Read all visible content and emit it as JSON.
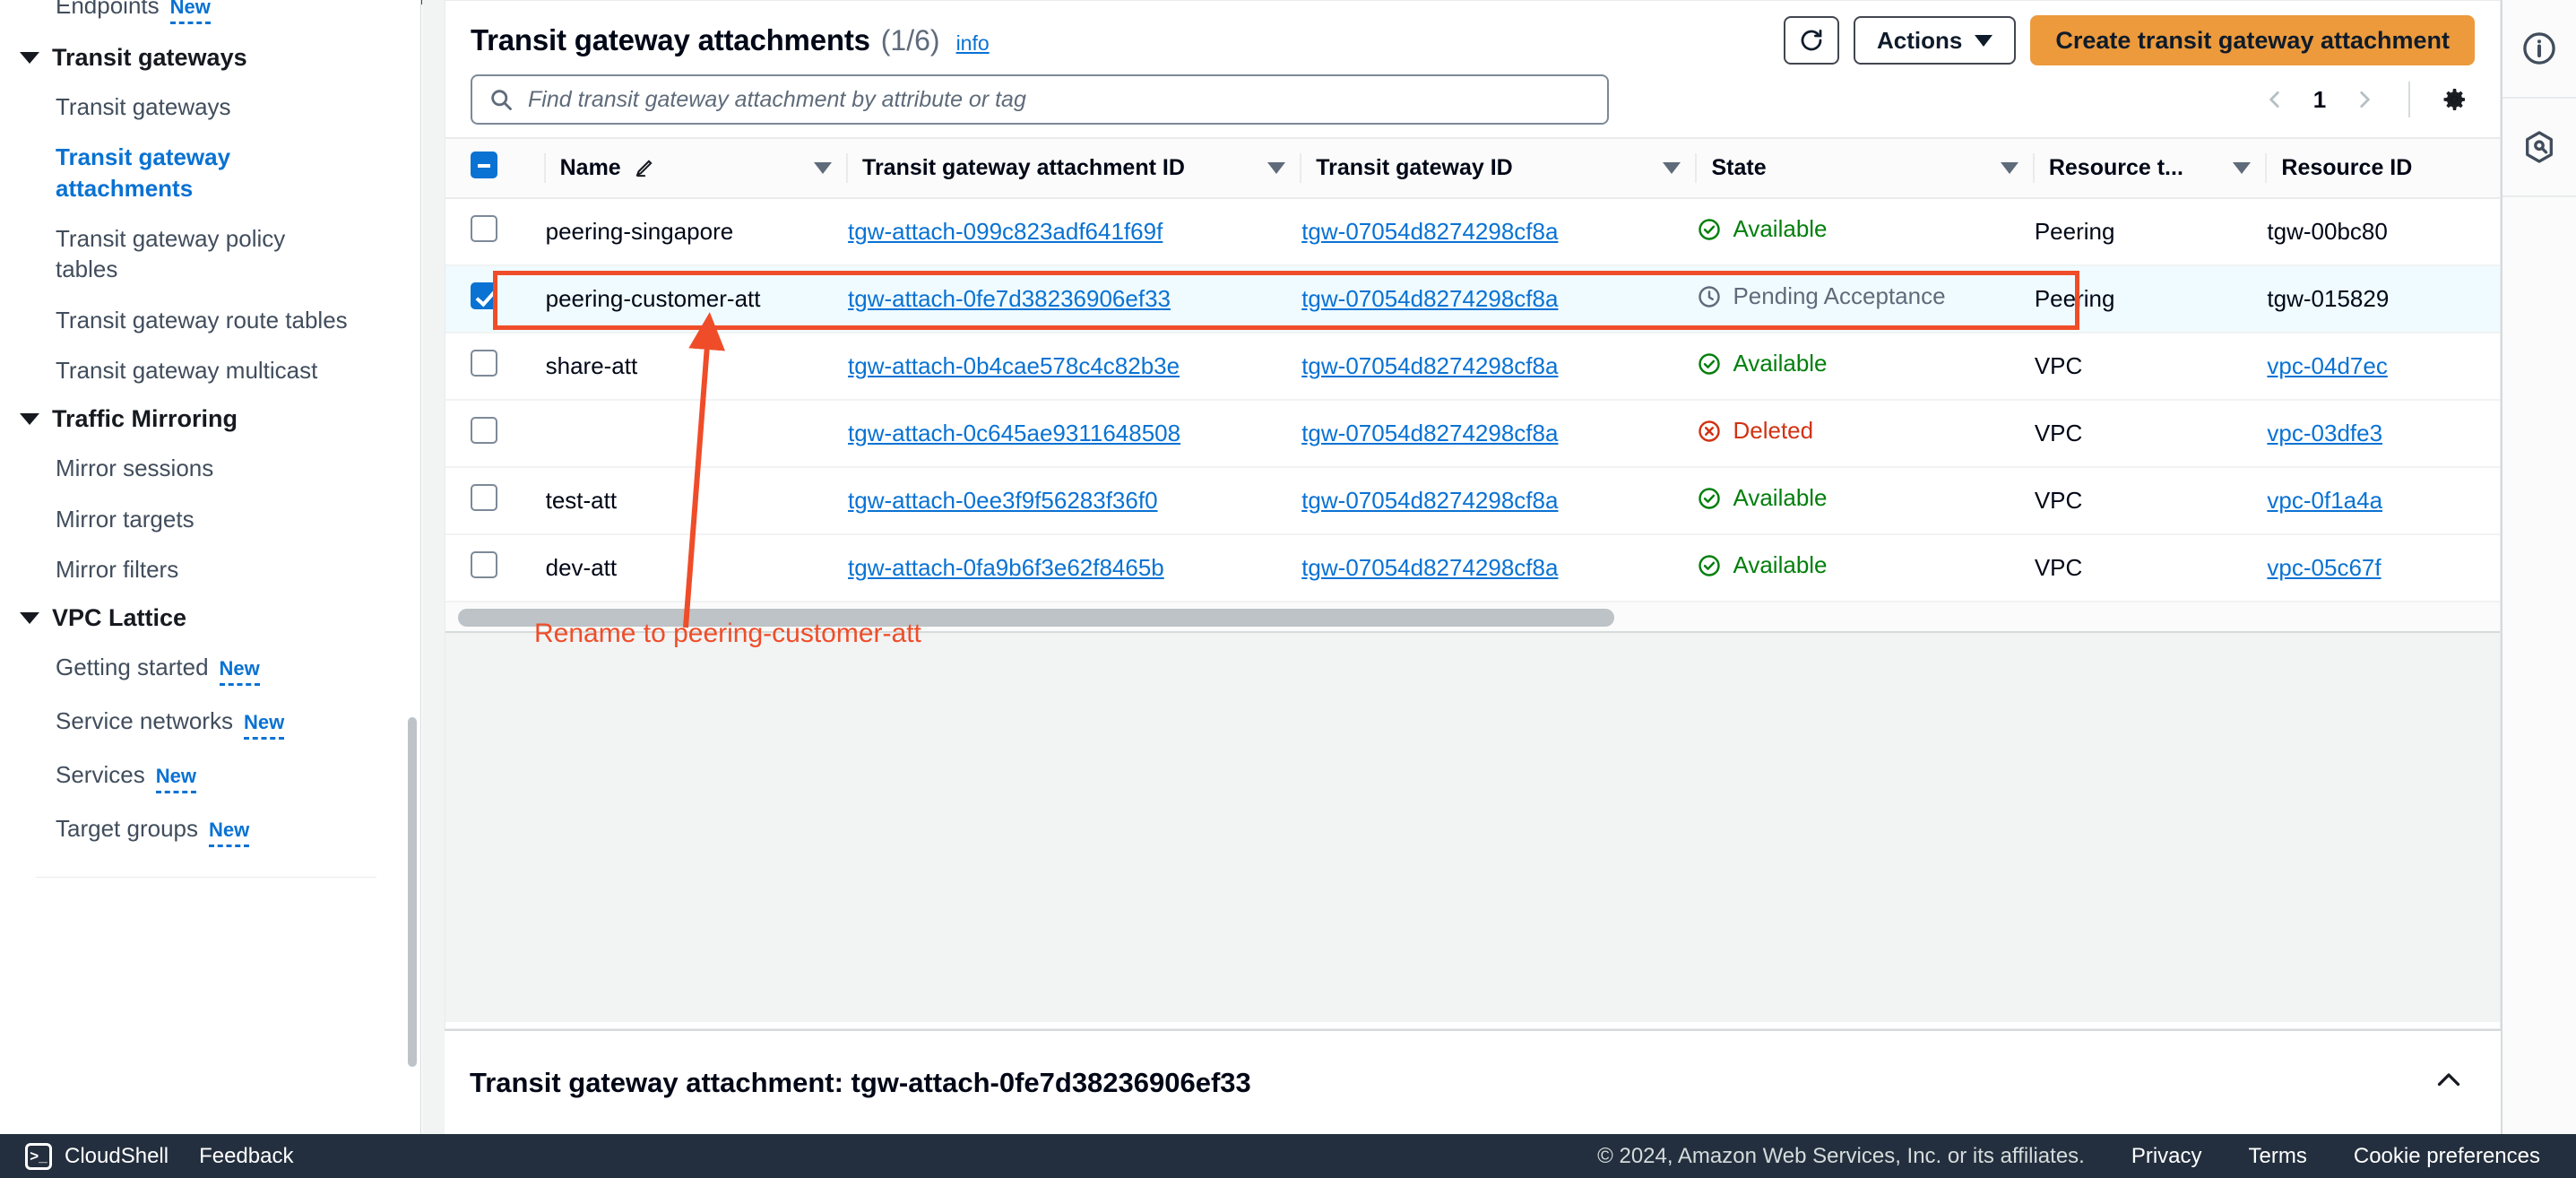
{
  "sidebar": {
    "cutoff_item": {
      "label": "Endpoints",
      "badge": "New"
    },
    "groups": [
      {
        "title": "Transit gateways",
        "items": [
          {
            "label": "Transit gateways",
            "active": false,
            "badge": ""
          },
          {
            "label": "Transit gateway attachments",
            "active": true,
            "badge": ""
          },
          {
            "label": "Transit gateway policy tables",
            "active": false,
            "badge": ""
          },
          {
            "label": "Transit gateway route tables",
            "active": false,
            "badge": ""
          },
          {
            "label": "Transit gateway multicast",
            "active": false,
            "badge": ""
          }
        ]
      },
      {
        "title": "Traffic Mirroring",
        "items": [
          {
            "label": "Mirror sessions",
            "active": false,
            "badge": ""
          },
          {
            "label": "Mirror targets",
            "active": false,
            "badge": ""
          },
          {
            "label": "Mirror filters",
            "active": false,
            "badge": ""
          }
        ]
      },
      {
        "title": "VPC Lattice",
        "items": [
          {
            "label": "Getting started",
            "active": false,
            "badge": "New"
          },
          {
            "label": "Service networks",
            "active": false,
            "badge": "New"
          },
          {
            "label": "Services",
            "active": false,
            "badge": "New"
          },
          {
            "label": "Target groups",
            "active": false,
            "badge": "New"
          }
        ]
      }
    ]
  },
  "header": {
    "title": "Transit gateway attachments",
    "count": "(1/6)",
    "info_label": "info",
    "refresh_icon": "refresh-icon",
    "actions_label": "Actions",
    "create_label": "Create transit gateway attachment"
  },
  "search": {
    "placeholder": "Find transit gateway attachment by attribute or tag",
    "value": "",
    "icon": "search-icon"
  },
  "pagination": {
    "prev_icon": "chevron-left-icon",
    "page": "1",
    "next_icon": "chevron-right-icon",
    "settings_icon": "gear-icon"
  },
  "table": {
    "columns": [
      {
        "key": "name",
        "label": "Name",
        "has_edit_icon": true,
        "sortable": true
      },
      {
        "key": "attachment_id",
        "label": "Transit gateway attachment ID",
        "has_edit_icon": false,
        "sortable": true
      },
      {
        "key": "tgw_id",
        "label": "Transit gateway ID",
        "has_edit_icon": false,
        "sortable": true
      },
      {
        "key": "state",
        "label": "State",
        "has_edit_icon": false,
        "sortable": true
      },
      {
        "key": "resource_type",
        "label": "Resource t...",
        "has_edit_icon": false,
        "sortable": true
      },
      {
        "key": "resource_id",
        "label": "Resource ID",
        "has_edit_icon": false,
        "sortable": false
      }
    ],
    "select_all_state": "indeterminate",
    "rows": [
      {
        "selected": false,
        "name": "peering-singapore",
        "attachment_id": "tgw-attach-099c823adf641f69f",
        "tgw_id": "tgw-07054d8274298cf8a",
        "state": "Available",
        "state_kind": "ok",
        "resource_type": "Peering",
        "resource_id": "tgw-00bc80",
        "resource_id_link": false
      },
      {
        "selected": true,
        "name": "peering-customer-att",
        "attachment_id": "tgw-attach-0fe7d38236906ef33",
        "tgw_id": "tgw-07054d8274298cf8a",
        "state": "Pending Acceptance",
        "state_kind": "pending",
        "resource_type": "Peering",
        "resource_id": "tgw-015829",
        "resource_id_link": false
      },
      {
        "selected": false,
        "name": "share-att",
        "attachment_id": "tgw-attach-0b4cae578c4c82b3e",
        "tgw_id": "tgw-07054d8274298cf8a",
        "state": "Available",
        "state_kind": "ok",
        "resource_type": "VPC",
        "resource_id": "vpc-04d7ec",
        "resource_id_link": true
      },
      {
        "selected": false,
        "name": "",
        "attachment_id": "tgw-attach-0c645ae9311648508",
        "tgw_id": "tgw-07054d8274298cf8a",
        "state": "Deleted",
        "state_kind": "deleted",
        "resource_type": "VPC",
        "resource_id": "vpc-03dfe3",
        "resource_id_link": true
      },
      {
        "selected": false,
        "name": "test-att",
        "attachment_id": "tgw-attach-0ee3f9f56283f36f0",
        "tgw_id": "tgw-07054d8274298cf8a",
        "state": "Available",
        "state_kind": "ok",
        "resource_type": "VPC",
        "resource_id": "vpc-0f1a4a",
        "resource_id_link": true
      },
      {
        "selected": false,
        "name": "dev-att",
        "attachment_id": "tgw-attach-0fa9b6f3e62f8465b",
        "tgw_id": "tgw-07054d8274298cf8a",
        "state": "Available",
        "state_kind": "ok",
        "resource_type": "VPC",
        "resource_id": "vpc-05c67f",
        "resource_id_link": true
      }
    ]
  },
  "detail_panel": {
    "title": "Transit gateway attachment: tgw-attach-0fe7d38236906ef33",
    "collapse_icon": "chevron-up-icon"
  },
  "right_rail": {
    "items": [
      {
        "icon": "info-circle-icon"
      },
      {
        "icon": "shield-hex-icon"
      }
    ]
  },
  "footer": {
    "cloudshell_label": "CloudShell",
    "feedback_label": "Feedback",
    "copyright": "© 2024, Amazon Web Services, Inc. or its affiliates.",
    "links": [
      "Privacy",
      "Terms",
      "Cookie preferences"
    ]
  },
  "annotations": {
    "callout_text": "Rename to peering-customer-att",
    "color": "#ef4d29"
  },
  "colors": {
    "accent_orange": "#ec9a3c",
    "link_blue": "#0972d3",
    "success_green": "#037f0c",
    "error_red": "#d13212",
    "pending_grey": "#5f6b7a",
    "annotation_red": "#ef4d29",
    "footer_dark": "#232f3e"
  }
}
